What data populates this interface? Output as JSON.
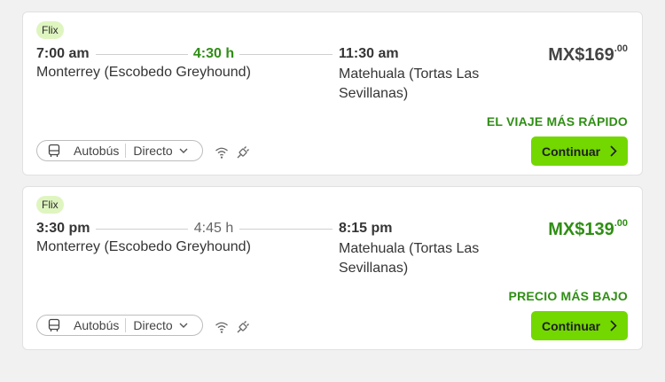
{
  "trips": [
    {
      "operator": "Flix",
      "departure_time": "7:00 am",
      "duration": "4:30 h",
      "arrival_time": "11:30 am",
      "departure_station": "Monterrey (Escobedo Greyhound)",
      "arrival_station": "Matehuala (Tortas Las Sevillanas)",
      "price_main": "MX$169",
      "price_cents": ".00",
      "highlight": "EL VIAJE MÁS RÁPIDO",
      "vehicle": "Autobús",
      "route_type": "Directo",
      "amenities": [
        "wifi-icon",
        "power-plug-icon"
      ],
      "button_label": "Continuar"
    },
    {
      "operator": "Flix",
      "departure_time": "3:30 pm",
      "duration": "4:45 h",
      "arrival_time": "8:15 pm",
      "departure_station": "Monterrey (Escobedo Greyhound)",
      "arrival_station": "Matehuala (Tortas Las Sevillanas)",
      "price_main": "MX$139",
      "price_cents": ".00",
      "highlight": "PRECIO MÁS BAJO",
      "vehicle": "Autobús",
      "route_type": "Directo",
      "amenities": [
        "wifi-icon",
        "power-plug-icon"
      ],
      "button_label": "Continuar"
    }
  ],
  "colors": {
    "accent": "#73d700",
    "highlight_green": "#2f8e14",
    "badge_bg": "#dff5c0"
  }
}
